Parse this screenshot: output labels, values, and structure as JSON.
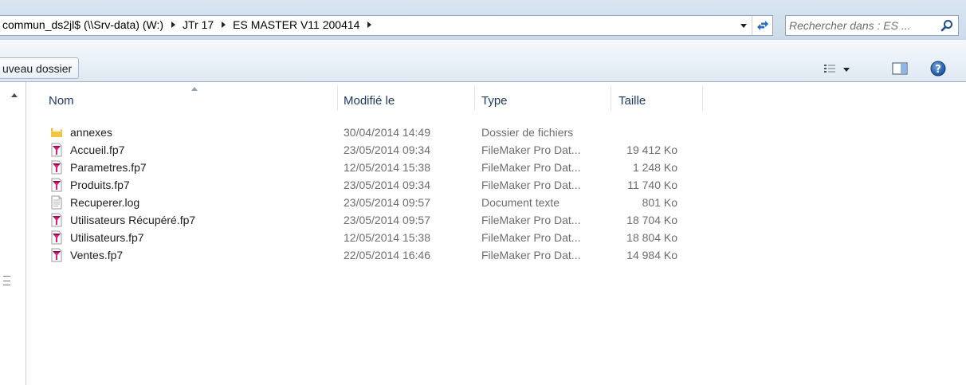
{
  "address": {
    "crumbs": [
      "commun_ds2jl$ (\\\\Srv-data) (W:)",
      "JTr 17",
      "ES MASTER V11 200414"
    ]
  },
  "search": {
    "placeholder": "Rechercher dans : ES ..."
  },
  "toolbar": {
    "new_folder_label": "uveau dossier"
  },
  "columns": {
    "name": "Nom",
    "modified": "Modifié le",
    "type": "Type",
    "size": "Taille"
  },
  "files": [
    {
      "name": "annexes",
      "modified": "30/04/2014 14:49",
      "type": "Dossier de fichiers",
      "size": "",
      "icon": "folder-icon"
    },
    {
      "name": "Accueil.fp7",
      "modified": "23/05/2014 09:34",
      "type": "FileMaker Pro Dat...",
      "size": "19 412 Ko",
      "icon": "filemaker-file-icon"
    },
    {
      "name": "Parametres.fp7",
      "modified": "12/05/2014 15:38",
      "type": "FileMaker Pro Dat...",
      "size": "1 248 Ko",
      "icon": "filemaker-file-icon"
    },
    {
      "name": "Produits.fp7",
      "modified": "23/05/2014 09:34",
      "type": "FileMaker Pro Dat...",
      "size": "11 740 Ko",
      "icon": "filemaker-file-icon"
    },
    {
      "name": "Recuperer.log",
      "modified": "23/05/2014 09:57",
      "type": "Document texte",
      "size": "801 Ko",
      "icon": "text-document-icon"
    },
    {
      "name": "Utilisateurs Récupéré.fp7",
      "modified": "23/05/2014 09:57",
      "type": "FileMaker Pro Dat...",
      "size": "18 704 Ko",
      "icon": "filemaker-file-icon"
    },
    {
      "name": "Utilisateurs.fp7",
      "modified": "12/05/2014 15:38",
      "type": "FileMaker Pro Dat...",
      "size": "18 804 Ko",
      "icon": "filemaker-file-icon"
    },
    {
      "name": "Ventes.fp7",
      "modified": "22/05/2014 16:46",
      "type": "FileMaker Pro Dat...",
      "size": "14 984 Ko",
      "icon": "filemaker-file-icon"
    }
  ],
  "colors": {
    "header_text": "#1f3a64",
    "secondary_text": "#6d6d6d",
    "filemaker_pink": "#e0197d",
    "folder_yellow": "#f2c640"
  }
}
